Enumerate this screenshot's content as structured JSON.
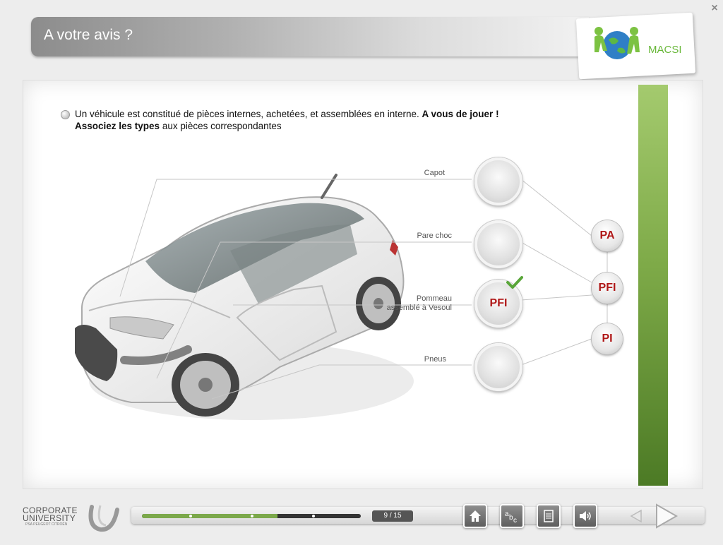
{
  "window": {
    "close_symbol": "×"
  },
  "header": {
    "title": "A votre avis ?",
    "logo_text": "MACSI"
  },
  "instruction": {
    "part1": "Un véhicule est constitué de pièces internes, achetées, et assemblées en interne. ",
    "bold1": "A vous de jouer !",
    "bold2": "Associez les types",
    "part2": " aux pièces correspondantes"
  },
  "parts": [
    {
      "label": "Capot"
    },
    {
      "label": "Pare choc"
    },
    {
      "label_line1": "Pommeau",
      "label_line2": "assemblé à Vesoul",
      "placed": "PFI"
    },
    {
      "label": "Pneus"
    }
  ],
  "types": [
    {
      "label": "PA"
    },
    {
      "label": "PFI"
    },
    {
      "label": "PI"
    }
  ],
  "footer": {
    "brand_line1": "CORPORATE",
    "brand_line2": "UNIVERSITY",
    "brand_sub": "PSA PEUGEOT CITROËN",
    "page_counter": "9 / 15",
    "progress": 0.62
  },
  "icons": {
    "home": "home-icon",
    "glossary": "glossary-icon",
    "document": "document-icon",
    "sound": "sound-icon",
    "prev": "arrow-left-icon",
    "next": "arrow-right-icon"
  },
  "colors": {
    "accent_green": "#7ba84a",
    "type_red": "#b01818",
    "logo_green": "#69b83a"
  }
}
